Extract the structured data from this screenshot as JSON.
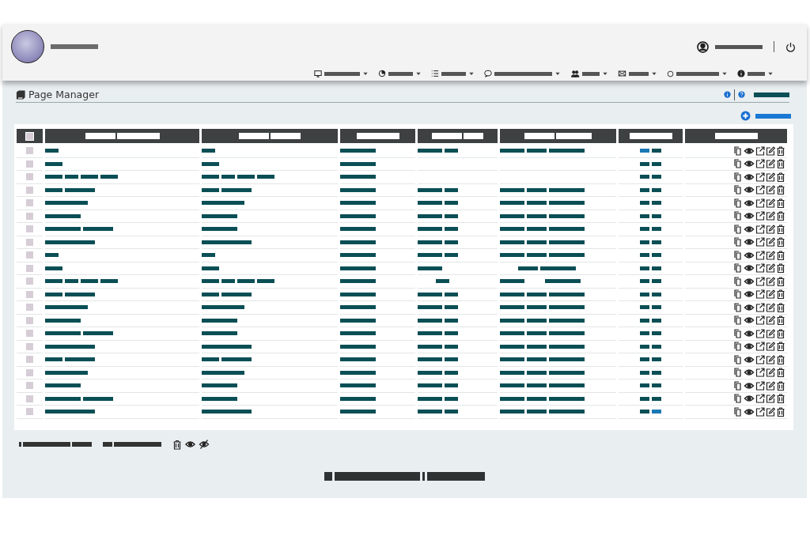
{
  "header": {
    "logo": {
      "kind": "avatar"
    },
    "site_name": [
      {
        "kind": "xxxl"
      }
    ],
    "user": {
      "name": [
        {
          "kind": "xxxl"
        }
      ]
    },
    "menu": [
      {
        "kind": "monitor",
        "label": [
          {
            "kind": "l"
          }
        ]
      },
      {
        "kind": "pie",
        "label": [
          {
            "kind": "m"
          }
        ]
      },
      {
        "kind": "list",
        "label": [
          {
            "kind": "m"
          }
        ]
      },
      {
        "kind": "chat",
        "label": [
          {
            "kind": "huge"
          }
        ]
      },
      {
        "kind": "users",
        "label": [
          {
            "kind": "s"
          }
        ]
      },
      {
        "kind": "mail",
        "label": [
          {
            "kind": "sm"
          }
        ]
      },
      {
        "kind": "circle",
        "label": [
          {
            "kind": "xl"
          }
        ]
      },
      {
        "kind": "info",
        "label": [
          {
            "kind": "s"
          }
        ]
      }
    ]
  },
  "page": {
    "title": "Page Manager",
    "action_label": [
      {
        "kind": "l"
      }
    ],
    "add_label": [
      {
        "kind": "l"
      }
    ]
  },
  "table": {
    "columns": [
      {
        "kind": "select",
        "checked": false
      },
      {
        "kind": "text",
        "label": [
          {
            "kind": "ml"
          },
          {
            "kind": "xl"
          }
        ]
      },
      {
        "kind": "text",
        "label": [
          {
            "kind": "ml"
          },
          {
            "kind": "ml"
          }
        ]
      },
      {
        "kind": "text",
        "label": [
          {
            "kind": "xl"
          }
        ]
      },
      {
        "kind": "text",
        "label": [
          {
            "kind": "ml"
          },
          {
            "kind": "sm"
          }
        ]
      },
      {
        "kind": "text",
        "label": [
          {
            "kind": "ml"
          },
          {
            "kind": "l"
          }
        ]
      },
      {
        "kind": "text",
        "label": [
          {
            "kind": "xl"
          }
        ]
      },
      {
        "kind": "text",
        "label": [
          {
            "kind": "xl"
          }
        ]
      }
    ],
    "rows": [
      {
        "checked": false,
        "c1": [
          {
            "kind": "xs"
          }
        ],
        "c2": [
          {
            "kind": "xs"
          }
        ],
        "c3": [
          {
            "kind": "l"
          }
        ],
        "c4": [
          {
            "kind": "m"
          },
          {
            "kind": "xs"
          }
        ],
        "c5": [
          {
            "kind": "m"
          },
          {
            "kind": "sm"
          },
          {
            "kind": "l"
          }
        ],
        "status": [
          {
            "color": "#1a78b4"
          },
          {
            "color": "#0a4f55"
          }
        ]
      },
      {
        "checked": false,
        "c1": [
          {
            "kind": "s"
          }
        ],
        "c2": [
          {
            "kind": "s"
          }
        ],
        "c3": [
          {
            "kind": "l"
          }
        ],
        "status": [
          {
            "color": "#0a4f55"
          },
          {
            "color": "#0a4f55"
          }
        ]
      },
      {
        "checked": false,
        "c1": [
          {
            "kind": "s"
          },
          {
            "kind": "xs"
          },
          {
            "kind": "s"
          },
          {
            "kind": "s"
          }
        ],
        "c2": [
          {
            "kind": "s"
          },
          {
            "kind": "xs"
          },
          {
            "kind": "s"
          },
          {
            "kind": "s"
          }
        ],
        "c3": [
          {
            "kind": "l"
          }
        ],
        "status": [
          {
            "color": "#0a4f55"
          },
          {
            "color": "#0a4f55"
          }
        ]
      },
      {
        "checked": false,
        "c1": [
          {
            "kind": "s"
          },
          {
            "kind": "ml"
          }
        ],
        "c2": [
          {
            "kind": "s"
          },
          {
            "kind": "ml"
          }
        ],
        "c3": [
          {
            "kind": "l"
          }
        ],
        "c4": [
          {
            "kind": "m"
          },
          {
            "kind": "xs"
          }
        ],
        "c5": [
          {
            "kind": "m"
          },
          {
            "kind": "sm"
          },
          {
            "kind": "l"
          }
        ],
        "status": [
          {
            "color": "#0a4f55"
          },
          {
            "color": "#0a4f55"
          }
        ]
      },
      {
        "checked": false,
        "c1": [
          {
            "kind": "xl"
          }
        ],
        "c2": [
          {
            "kind": "xl"
          }
        ],
        "c3": [
          {
            "kind": "l"
          }
        ],
        "c4": [
          {
            "kind": "m"
          },
          {
            "kind": "xs"
          }
        ],
        "c5": [
          {
            "kind": "m"
          },
          {
            "kind": "sm"
          },
          {
            "kind": "l"
          }
        ],
        "status": [
          {
            "color": "#0a4f55"
          },
          {
            "color": "#0a4f55"
          }
        ]
      },
      {
        "checked": false,
        "c1": [
          {
            "kind": "l"
          }
        ],
        "c2": [
          {
            "kind": "l"
          }
        ],
        "c3": [
          {
            "kind": "l"
          }
        ],
        "c4": [
          {
            "kind": "m"
          },
          {
            "kind": "xs"
          }
        ],
        "c5": [
          {
            "kind": "m"
          },
          {
            "kind": "sm"
          },
          {
            "kind": "l"
          }
        ],
        "status": [
          {
            "color": "#0a4f55"
          },
          {
            "color": "#0a4f55"
          }
        ]
      },
      {
        "checked": false,
        "c1": [
          {
            "kind": "l"
          },
          {
            "kind": "ml"
          }
        ],
        "c2": [
          {
            "kind": "l"
          }
        ],
        "c3": [
          {
            "kind": "l"
          }
        ],
        "c4": [
          {
            "kind": "m"
          },
          {
            "kind": "xs"
          }
        ],
        "c5": [
          {
            "kind": "m"
          },
          {
            "kind": "sm"
          },
          {
            "kind": "l"
          }
        ],
        "status": [
          {
            "color": "#0a4f55"
          },
          {
            "color": "#0a4f55"
          }
        ]
      },
      {
        "checked": false,
        "c1": [
          {
            "kind": "xxl"
          }
        ],
        "c2": [
          {
            "kind": "xxl"
          }
        ],
        "c3": [
          {
            "kind": "l"
          }
        ],
        "c4": [
          {
            "kind": "m"
          },
          {
            "kind": "xs"
          }
        ],
        "c5": [
          {
            "kind": "m"
          },
          {
            "kind": "sm"
          },
          {
            "kind": "l"
          }
        ],
        "status": [
          {
            "color": "#0a4f55"
          },
          {
            "color": "#0a4f55"
          }
        ]
      },
      {
        "checked": false,
        "c1": [
          {
            "kind": "xs"
          }
        ],
        "c2": [
          {
            "kind": "xs"
          }
        ],
        "c3": [
          {
            "kind": "l"
          }
        ],
        "c4": [
          {
            "kind": "m"
          },
          {
            "kind": "xs"
          }
        ],
        "c5": [
          {
            "kind": "m"
          },
          {
            "kind": "sm"
          },
          {
            "kind": "l"
          }
        ],
        "status": [
          {
            "color": "#0a4f55"
          },
          {
            "color": "#0a4f55"
          }
        ]
      },
      {
        "checked": false,
        "c1": [
          {
            "kind": "s"
          }
        ],
        "c2": [
          {
            "kind": "s"
          }
        ],
        "c3": [
          {
            "kind": "l"
          }
        ],
        "c4": [
          {
            "kind": "m"
          }
        ],
        "c5": [
          {
            "kind": "gap"
          },
          {
            "kind": "sm"
          },
          {
            "kind": "l"
          }
        ],
        "status": [
          {
            "color": "#0a4f55"
          },
          {
            "color": "#0a4f55"
          }
        ]
      },
      {
        "checked": false,
        "c1": [
          {
            "kind": "s"
          },
          {
            "kind": "xs"
          },
          {
            "kind": "s"
          },
          {
            "kind": "s"
          }
        ],
        "c2": [
          {
            "kind": "s"
          },
          {
            "kind": "xs"
          },
          {
            "kind": "s"
          },
          {
            "kind": "s"
          }
        ],
        "c3": [
          {
            "kind": "l"
          }
        ],
        "c4": [
          {
            "kind": "gap"
          },
          {
            "kind": "xs"
          }
        ],
        "c5": [
          {
            "kind": "m"
          },
          {
            "kind": "gap"
          },
          {
            "kind": "l"
          }
        ],
        "status": [
          {
            "color": "#0a4f55"
          },
          {
            "color": "#0a4f55"
          }
        ]
      },
      {
        "checked": false,
        "c1": [
          {
            "kind": "s"
          },
          {
            "kind": "ml"
          }
        ],
        "c2": [
          {
            "kind": "s"
          },
          {
            "kind": "ml"
          }
        ],
        "c3": [
          {
            "kind": "l"
          }
        ],
        "c4": [
          {
            "kind": "m"
          },
          {
            "kind": "xs"
          }
        ],
        "c5": [
          {
            "kind": "m"
          },
          {
            "kind": "sm"
          },
          {
            "kind": "l"
          }
        ],
        "status": [
          {
            "color": "#0a4f55"
          },
          {
            "color": "#0a4f55"
          }
        ]
      },
      {
        "checked": false,
        "c1": [
          {
            "kind": "xl"
          }
        ],
        "c2": [
          {
            "kind": "xl"
          }
        ],
        "c3": [
          {
            "kind": "l"
          }
        ],
        "c4": [
          {
            "kind": "m"
          },
          {
            "kind": "xs"
          }
        ],
        "c5": [
          {
            "kind": "m"
          },
          {
            "kind": "sm"
          },
          {
            "kind": "l"
          }
        ],
        "status": [
          {
            "color": "#0a4f55"
          },
          {
            "color": "#0a4f55"
          }
        ]
      },
      {
        "checked": false,
        "c1": [
          {
            "kind": "l"
          }
        ],
        "c2": [
          {
            "kind": "l"
          }
        ],
        "c3": [
          {
            "kind": "l"
          }
        ],
        "c4": [
          {
            "kind": "m"
          },
          {
            "kind": "xs"
          }
        ],
        "c5": [
          {
            "kind": "m"
          },
          {
            "kind": "sm"
          },
          {
            "kind": "l"
          }
        ],
        "status": [
          {
            "color": "#0a4f55"
          },
          {
            "color": "#0a4f55"
          }
        ]
      },
      {
        "checked": false,
        "c1": [
          {
            "kind": "l"
          },
          {
            "kind": "ml"
          }
        ],
        "c2": [
          {
            "kind": "l"
          }
        ],
        "c3": [
          {
            "kind": "l"
          }
        ],
        "c4": [
          {
            "kind": "m"
          },
          {
            "kind": "xs"
          }
        ],
        "c5": [
          {
            "kind": "m"
          },
          {
            "kind": "sm"
          },
          {
            "kind": "l"
          }
        ],
        "status": [
          {
            "color": "#0a4f55"
          },
          {
            "color": "#0a4f55"
          }
        ]
      },
      {
        "checked": false,
        "c1": [
          {
            "kind": "xxl"
          }
        ],
        "c2": [
          {
            "kind": "xxl"
          }
        ],
        "c3": [
          {
            "kind": "l"
          }
        ],
        "c4": [
          {
            "kind": "m"
          },
          {
            "kind": "xs"
          }
        ],
        "c5": [
          {
            "kind": "m"
          },
          {
            "kind": "sm"
          },
          {
            "kind": "l"
          }
        ],
        "status": [
          {
            "color": "#0a4f55"
          },
          {
            "color": "#0a4f55"
          }
        ]
      },
      {
        "checked": false,
        "c1": [
          {
            "kind": "s"
          },
          {
            "kind": "ml"
          }
        ],
        "c2": [
          {
            "kind": "s"
          },
          {
            "kind": "ml"
          }
        ],
        "c3": [
          {
            "kind": "l"
          }
        ],
        "c4": [
          {
            "kind": "m"
          },
          {
            "kind": "xs"
          }
        ],
        "c5": [
          {
            "kind": "m"
          },
          {
            "kind": "sm"
          },
          {
            "kind": "l"
          }
        ],
        "status": [
          {
            "color": "#0a4f55"
          },
          {
            "color": "#0a4f55"
          }
        ]
      },
      {
        "checked": false,
        "c1": [
          {
            "kind": "xl"
          }
        ],
        "c2": [
          {
            "kind": "xl"
          }
        ],
        "c3": [
          {
            "kind": "l"
          }
        ],
        "c4": [
          {
            "kind": "m"
          },
          {
            "kind": "xs"
          }
        ],
        "c5": [
          {
            "kind": "m"
          },
          {
            "kind": "sm"
          },
          {
            "kind": "l"
          }
        ],
        "status": [
          {
            "color": "#0a4f55"
          },
          {
            "color": "#0a4f55"
          }
        ]
      },
      {
        "checked": false,
        "c1": [
          {
            "kind": "l"
          }
        ],
        "c2": [
          {
            "kind": "l"
          }
        ],
        "c3": [
          {
            "kind": "l"
          }
        ],
        "c4": [
          {
            "kind": "m"
          },
          {
            "kind": "xs"
          }
        ],
        "c5": [
          {
            "kind": "m"
          },
          {
            "kind": "sm"
          },
          {
            "kind": "l"
          }
        ],
        "status": [
          {
            "color": "#0a4f55"
          },
          {
            "color": "#0a4f55"
          }
        ]
      },
      {
        "checked": false,
        "c1": [
          {
            "kind": "l"
          },
          {
            "kind": "ml"
          }
        ],
        "c2": [
          {
            "kind": "l"
          }
        ],
        "c3": [
          {
            "kind": "l"
          }
        ],
        "c4": [
          {
            "kind": "m"
          },
          {
            "kind": "xs"
          }
        ],
        "c5": [
          {
            "kind": "m"
          },
          {
            "kind": "sm"
          },
          {
            "kind": "l"
          }
        ],
        "status": [
          {
            "color": "#0a4f55"
          },
          {
            "color": "#0a4f55"
          }
        ]
      },
      {
        "checked": false,
        "c1": [
          {
            "kind": "xxl"
          }
        ],
        "c2": [
          {
            "kind": "xxl"
          }
        ],
        "c3": [
          {
            "kind": "l"
          }
        ],
        "c4": [
          {
            "kind": "m"
          },
          {
            "kind": "xs"
          }
        ],
        "c5": [
          {
            "kind": "m"
          },
          {
            "kind": "sm"
          },
          {
            "kind": "l"
          }
        ],
        "status": [
          {
            "color": "#0a4f55"
          },
          {
            "color": "#1a78b4"
          }
        ]
      }
    ]
  },
  "footer": {
    "selection_label": [
      {
        "kind": "bar"
      },
      {
        "kind": "xxxl"
      },
      {
        "kind": "sm"
      }
    ],
    "bulk_label": [
      {
        "kind": "xxs"
      },
      {
        "kind": "xxxl"
      }
    ],
    "pagination": [
      {
        "kind": "blk"
      },
      {
        "kind": "huge2"
      },
      {
        "kind": "bar"
      },
      {
        "kind": "huge"
      }
    ]
  }
}
